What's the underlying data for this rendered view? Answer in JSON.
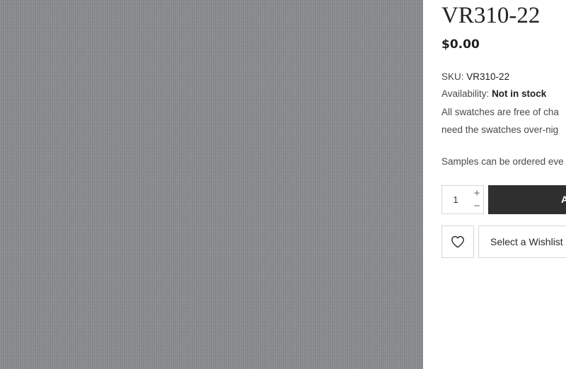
{
  "product": {
    "title": "VR310-22",
    "price": "$0.00",
    "sku_label": "SKU:",
    "sku_value": "VR310-22",
    "availability_label": "Availability:",
    "availability_value": "Not in stock",
    "description": {
      "line1": "All swatches are free of cha",
      "line2": "need the swatches over-nig",
      "line3": "Samples can be ordered eve"
    }
  },
  "purchase": {
    "quantity": "1",
    "increment_symbol": "+",
    "decrement_symbol": "−",
    "add_button_label": "A"
  },
  "wishlist": {
    "heart_icon": "heart-icon",
    "select_label": "Select a Wishlist"
  },
  "colors": {
    "swatch": "#8d8f91",
    "button_dark": "#2f2f2f",
    "border": "#d6d6d6"
  }
}
